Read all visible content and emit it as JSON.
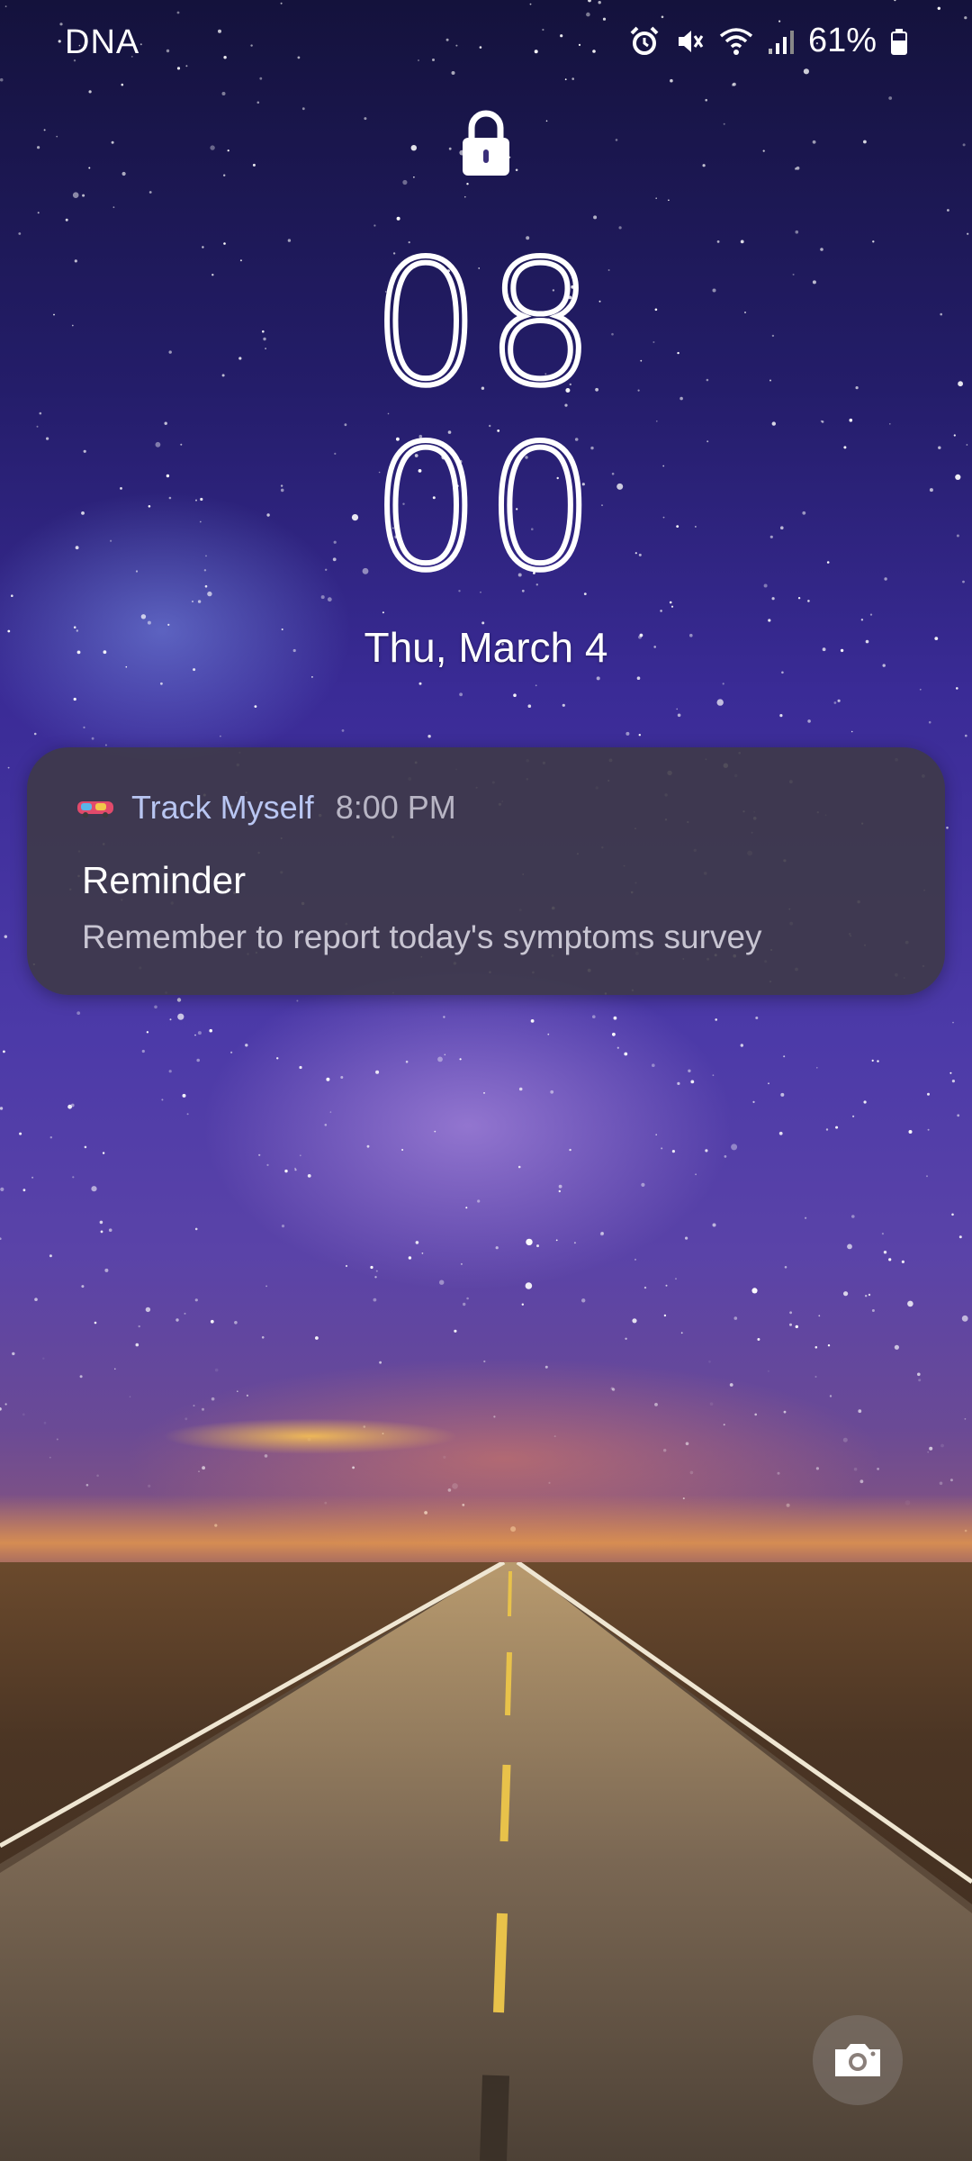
{
  "status_bar": {
    "carrier": "DNA",
    "battery": "61%",
    "icons": [
      "alarm-icon",
      "mute-icon",
      "wifi-icon",
      "signal-icon",
      "battery-icon"
    ]
  },
  "lock": {
    "icon": "lock-icon"
  },
  "clock": {
    "hours": "08",
    "minutes": "00"
  },
  "date": "Thu, March 4",
  "notification": {
    "app_name": "Track Myself",
    "time": "8:00 PM",
    "title": "Reminder",
    "body": "Remember to report today's symptoms survey"
  },
  "shortcuts": {
    "camera_icon": "camera-icon"
  }
}
